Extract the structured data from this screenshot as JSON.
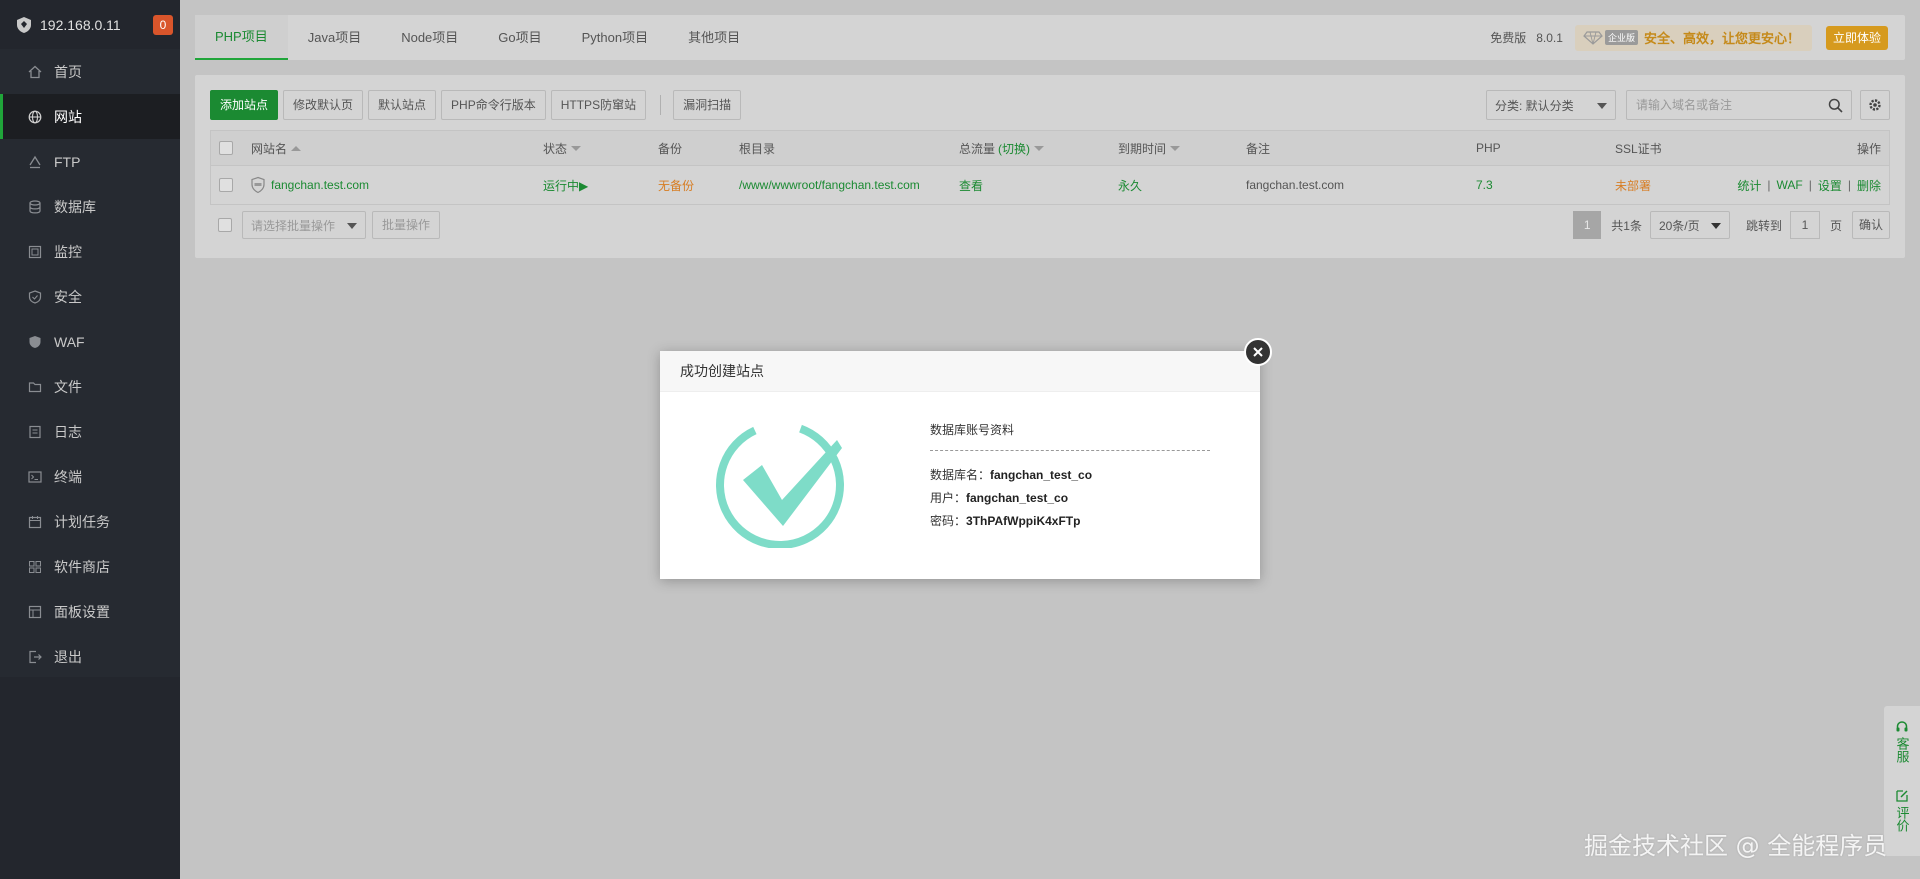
{
  "sidebar": {
    "ip": "192.168.0.11",
    "badge": "0",
    "items": [
      {
        "label": "首页",
        "icon": "home-icon"
      },
      {
        "label": "网站",
        "icon": "globe-icon",
        "active": true
      },
      {
        "label": "FTP",
        "icon": "ftp-icon"
      },
      {
        "label": "数据库",
        "icon": "database-icon"
      },
      {
        "label": "监控",
        "icon": "monitor-icon"
      },
      {
        "label": "安全",
        "icon": "shield-icon"
      },
      {
        "label": "WAF",
        "icon": "waf-shield-icon"
      },
      {
        "label": "文件",
        "icon": "folder-icon"
      },
      {
        "label": "日志",
        "icon": "log-icon"
      },
      {
        "label": "终端",
        "icon": "terminal-icon"
      },
      {
        "label": "计划任务",
        "icon": "calendar-icon"
      },
      {
        "label": "软件商店",
        "icon": "grid-icon"
      },
      {
        "label": "面板设置",
        "icon": "settings-icon"
      },
      {
        "label": "退出",
        "icon": "logout-icon"
      }
    ]
  },
  "tabs": [
    "PHP项目",
    "Java项目",
    "Node项目",
    "Go项目",
    "Python项目",
    "其他项目"
  ],
  "header": {
    "edition": "免费版",
    "version": "8.0.1",
    "enterprise_tag": "企业版",
    "slogan": "安全、高效，让您更安心！",
    "trial": "立即体验"
  },
  "toolbar": {
    "buttons": [
      "添加站点",
      "修改默认页",
      "默认站点",
      "PHP命令行版本",
      "HTTPS防窜站"
    ],
    "scan": "漏洞扫描",
    "category": "分类: 默认分类",
    "search_placeholder": "请输入域名或备注"
  },
  "table": {
    "headers": {
      "name": "网站名",
      "status": "状态",
      "backup": "备份",
      "root": "根目录",
      "traffic": "总流量",
      "traffic_switch": "(切换)",
      "expire": "到期时间",
      "remark": "备注",
      "php": "PHP",
      "ssl": "SSL证书",
      "ops": "操作"
    },
    "rows": [
      {
        "name": "fangchan.test.com",
        "status": "运行中▶",
        "backup": "无备份",
        "root": "/www/wwwroot/fangchan.test.com",
        "traffic": "查看",
        "expire": "永久",
        "remark": "fangchan.test.com",
        "php": "7.3",
        "ssl": "未部署",
        "ops": [
          "统计",
          "WAF",
          "设置",
          "删除"
        ]
      }
    ]
  },
  "footer": {
    "batch_placeholder": "请选择批量操作",
    "batch_btn": "批量操作",
    "page": "1",
    "total": "共1条",
    "page_size": "20条/页",
    "jump_label": "跳转到",
    "jump_value": "1",
    "page_unit": "页",
    "confirm": "确认"
  },
  "float": {
    "service": "客服",
    "review": "评价"
  },
  "watermark": "掘金技术社区 @ 全能程序员",
  "modal": {
    "title": "成功创建站点",
    "section": "数据库账号资料",
    "db_name_label": "数据库名：",
    "db_name": "fangchan_test_co",
    "user_label": "用户：",
    "user": "fangchan_test_co",
    "pwd_label": "密码：",
    "pwd": "3ThPAfWppiK4xFTp"
  },
  "colors": {
    "accent": "#20a53a",
    "check": "#7edcc8",
    "warning": "#d77d23"
  }
}
